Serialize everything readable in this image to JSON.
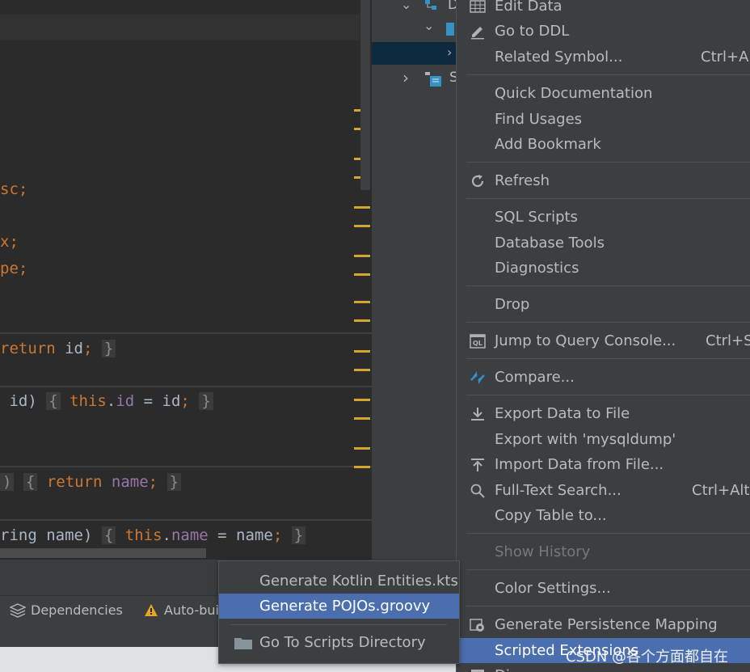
{
  "editor": {
    "lines": [
      {
        "t": [
          [
            "sc;",
            "kw"
          ]
        ]
      },
      {
        "t": [
          [
            "x;",
            "kw"
          ]
        ]
      },
      {
        "t": [
          [
            "pe;",
            "kw"
          ]
        ]
      },
      {
        "t": [
          [
            "return ",
            "kw"
          ],
          [
            "id",
            ""
          ],
          [
            ";",
            "kw"
          ],
          [
            " ",
            ""
          ],
          [
            "}",
            "br"
          ]
        ]
      },
      {
        "t": [
          [
            " id) ",
            ""
          ],
          [
            "{",
            "br"
          ],
          [
            " ",
            ""
          ],
          [
            "this",
            "kw"
          ],
          [
            ".",
            ""
          ],
          [
            "id",
            "fld"
          ],
          [
            " = id",
            ""
          ],
          [
            ";",
            "kw"
          ],
          [
            " ",
            ""
          ],
          [
            "}",
            "br"
          ]
        ]
      },
      {
        "t": [
          [
            ")",
            "br"
          ],
          [
            " ",
            ""
          ],
          [
            "{",
            "br"
          ],
          [
            " ",
            ""
          ],
          [
            "return ",
            "kw"
          ],
          [
            "name",
            "fld"
          ],
          [
            ";",
            "kw"
          ],
          [
            " ",
            ""
          ],
          [
            "}",
            "br"
          ]
        ]
      },
      {
        "t": [
          [
            "ring name) ",
            ""
          ],
          [
            "{",
            "br"
          ],
          [
            " ",
            ""
          ],
          [
            "this",
            "kw"
          ],
          [
            ".",
            ""
          ],
          [
            "name",
            "fld"
          ],
          [
            " = name",
            ""
          ],
          [
            ";",
            "kw"
          ],
          [
            " ",
            ""
          ],
          [
            "}",
            "br"
          ]
        ]
      }
    ]
  },
  "tree": {
    "labels": [
      "D",
      "S"
    ]
  },
  "toolwindows": {
    "dependencies": "Dependencies",
    "autobuild": "Auto-bui"
  },
  "menu": {
    "items": [
      {
        "label": "Edit Data",
        "icon": "table-icon"
      },
      {
        "label": "Go to DDL",
        "icon": "pencil-icon"
      },
      {
        "label": "Related Symbol...",
        "shortcut": "Ctrl+Al"
      },
      {
        "label": "Quick Documentation"
      },
      {
        "label": "Find Usages"
      },
      {
        "label": "Add Bookmark"
      },
      {
        "label": "Refresh",
        "icon": "refresh-icon"
      },
      {
        "label": "SQL Scripts"
      },
      {
        "label": "Database Tools"
      },
      {
        "label": "Diagnostics"
      },
      {
        "label": "Drop"
      },
      {
        "label": "Jump to Query Console...",
        "shortcut": "Ctrl+Sh",
        "icon": "ql-console-icon"
      },
      {
        "label": "Compare...",
        "icon": "compare-icon"
      },
      {
        "label": "Export Data to File",
        "icon": "export-icon"
      },
      {
        "label": "Export with 'mysqldump'"
      },
      {
        "label": "Import Data from File...",
        "icon": "import-icon"
      },
      {
        "label": "Full-Text Search...",
        "shortcut": "Ctrl+Alt+",
        "icon": "search-icon"
      },
      {
        "label": "Copy Table to..."
      },
      {
        "label": "Show History"
      },
      {
        "label": "Color Settings..."
      },
      {
        "label": "Generate Persistence Mapping",
        "icon": "persistence-icon"
      },
      {
        "label": "Scripted Extensions"
      },
      {
        "label": "Di"
      }
    ]
  },
  "submenu": {
    "items": [
      {
        "label": "Generate Kotlin Entities.kts"
      },
      {
        "label": "Generate POJOs.groovy"
      },
      {
        "label": "Go To Scripts Directory",
        "icon": "folder-icon"
      }
    ]
  },
  "watermark": "CSDN @各个方面都自在",
  "colors": {
    "selection": "#4b6eaf",
    "menu_bg": "#3c3f41",
    "keyword": "#cc7832",
    "field": "#9876aa",
    "fold_marker": "#d4a72c"
  }
}
